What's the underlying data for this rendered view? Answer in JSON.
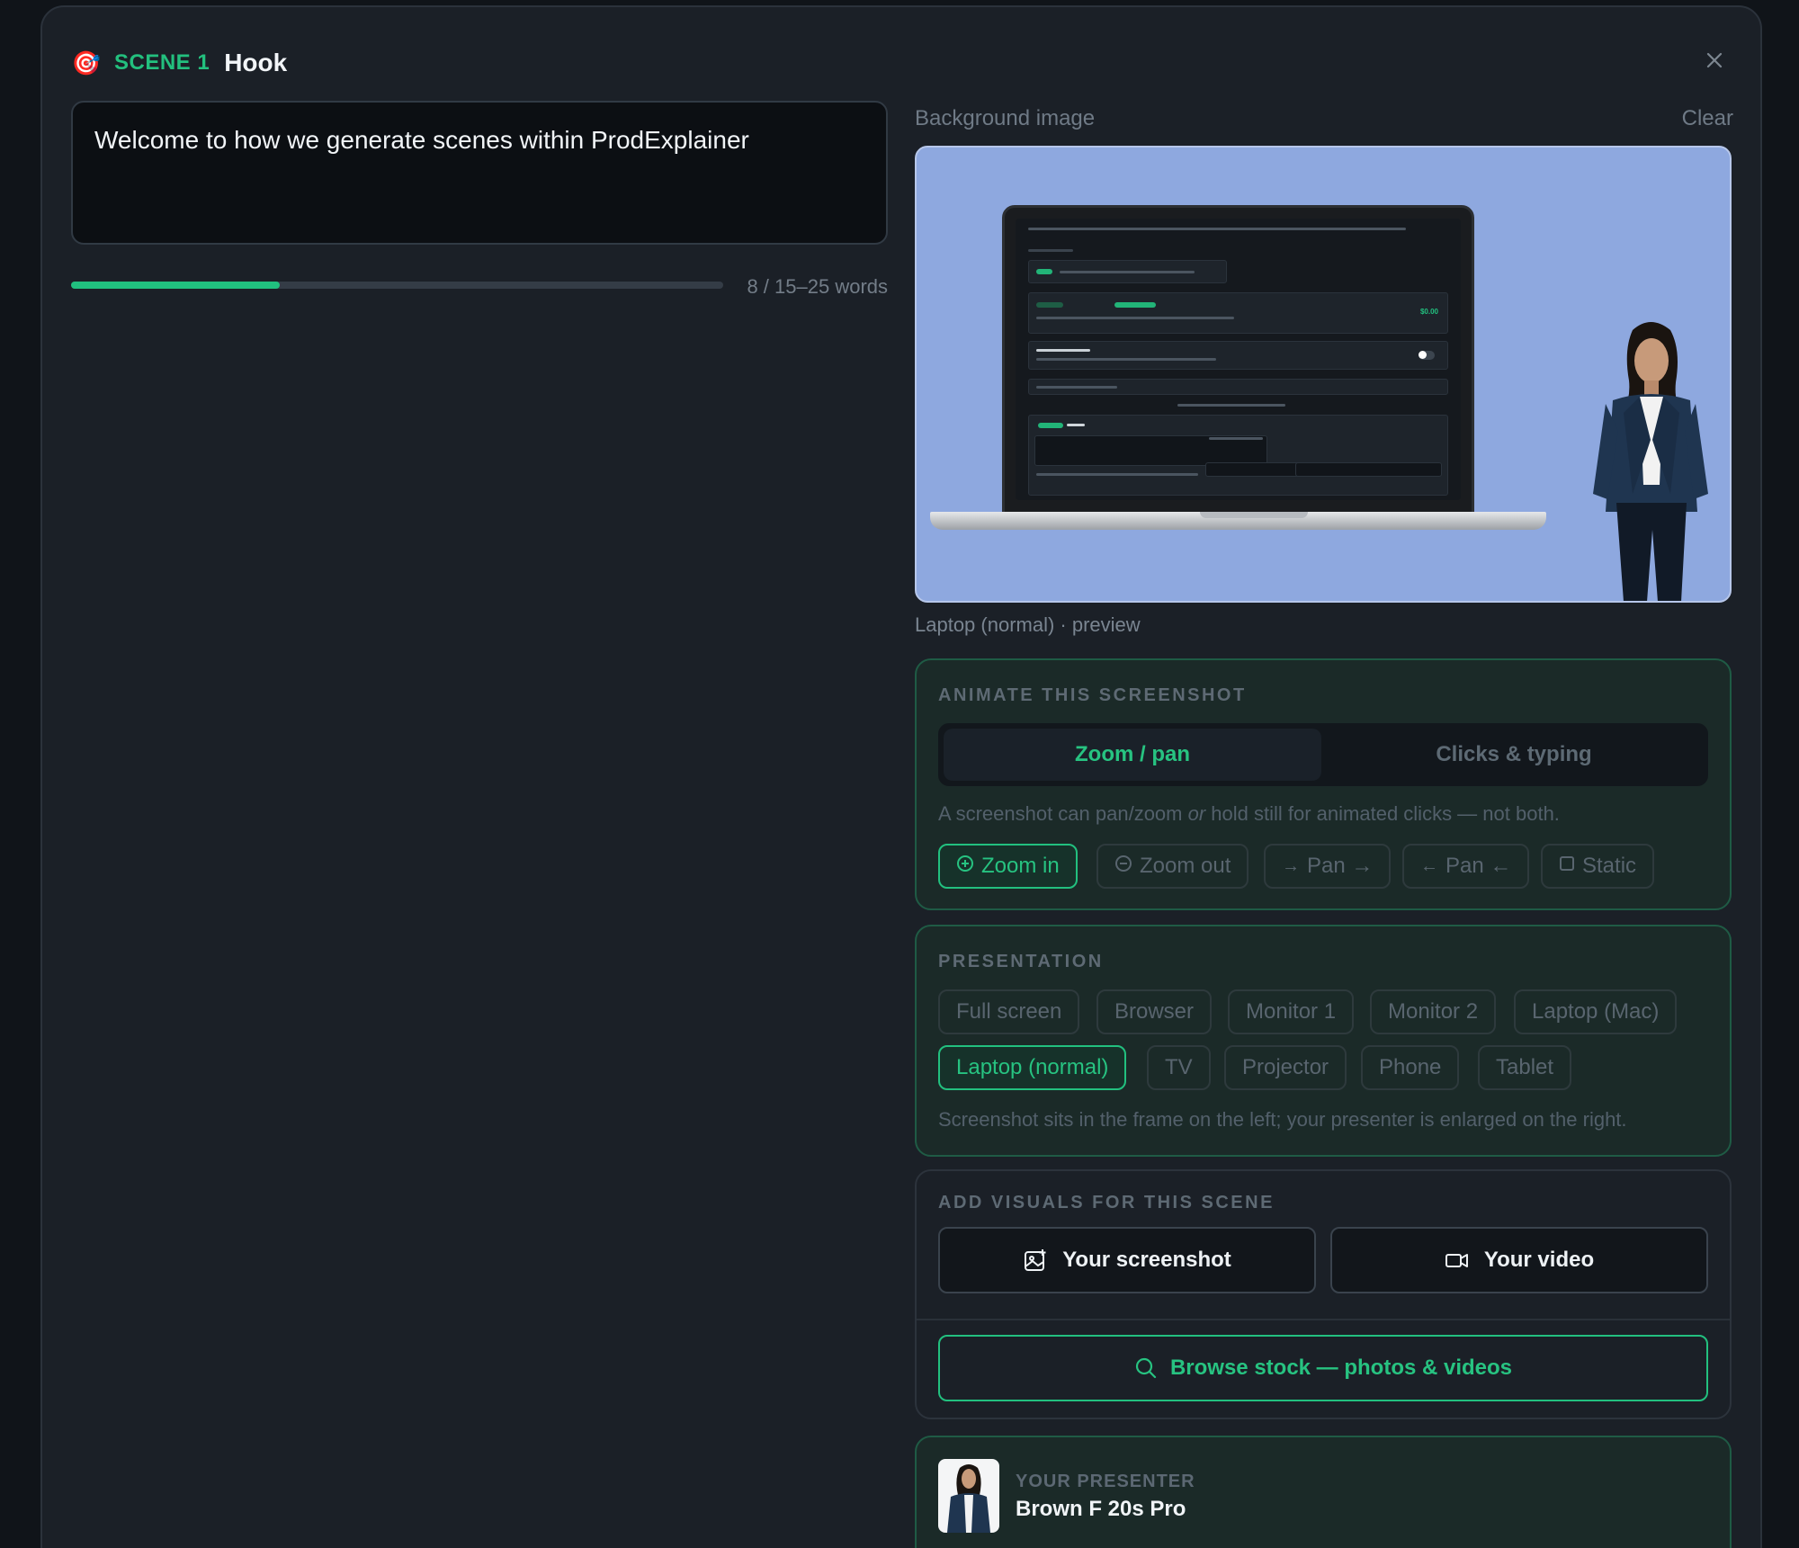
{
  "header": {
    "emoji": "🎯",
    "scene_number": "SCENE 1",
    "scene_title": "Hook",
    "close_symbol": "✕"
  },
  "script": {
    "text": "Welcome to how we generate scenes within ProdExplainer",
    "progress_fraction": 0.32,
    "word_count": "8 / 15–25 words"
  },
  "background": {
    "label": "Background image",
    "clear_label": "Clear",
    "preview_caption": "Laptop (normal) · preview"
  },
  "animate": {
    "title": "ANIMATE THIS SCREENSHOT",
    "tabs": [
      "Zoom / pan",
      "Clicks & typing"
    ],
    "active_tab": "Zoom / pan",
    "hint_before": "A screenshot can pan/zoom ",
    "hint_em": "or",
    "hint_after": " hold still for animated clicks — not both.",
    "options": [
      {
        "label": "Zoom in",
        "icon": "zoom-in-icon",
        "active": true
      },
      {
        "label": "Zoom out",
        "icon": "zoom-out-icon",
        "active": false
      },
      {
        "label": "Pan →",
        "icon": "arrow-right-icon",
        "active": false
      },
      {
        "label": "Pan ←",
        "icon": "arrow-left-icon",
        "active": false
      },
      {
        "label": "Static",
        "icon": "square-icon",
        "active": false
      }
    ]
  },
  "presentation": {
    "title": "PRESENTATION",
    "options_row1": [
      "Full screen",
      "Browser",
      "Monitor 1",
      "Monitor 2",
      "Laptop (Mac)"
    ],
    "options_row2": [
      "Laptop (normal)",
      "TV",
      "Projector",
      "Phone",
      "Tablet"
    ],
    "selected": "Laptop (normal)",
    "hint": "Screenshot sits in the frame on the left; your presenter is enlarged on the right."
  },
  "visuals": {
    "title": "ADD VISUALS FOR THIS SCENE",
    "screenshot_label": "Your screenshot",
    "video_label": "Your video",
    "stock_label": "Browse stock — photos & videos"
  },
  "presenter": {
    "label": "YOUR PRESENTER",
    "name": "Brown F 20s Pro"
  },
  "colors": {
    "accent": "#22c07f",
    "background": "#1b2027",
    "preview_bg": "#8ea8df"
  }
}
